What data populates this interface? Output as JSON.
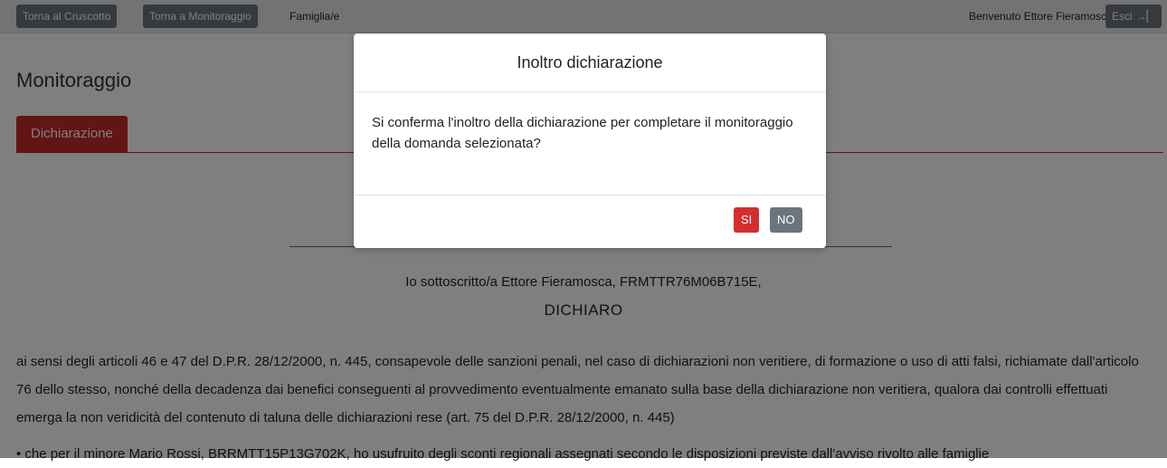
{
  "topbar": {
    "back_dashboard": "Torna al Cruscotto",
    "back_monitoring": "Torna a Monitoraggio",
    "breadcrumb": "Famiglia/e",
    "welcome": "Benvenuto Ettore Fieramosca",
    "logout_label": "Esci",
    "logout_icon": "sign-out-icon"
  },
  "page": {
    "title": "Monitoraggio",
    "tab": "Dichiarazione"
  },
  "declaration": {
    "subject": "Io sottoscritto/a Ettore Fieramosca, FRMTTR76M06B715E,",
    "heading": "DICHIARO",
    "paragraph": "ai sensi degli articoli 46 e 47 del D.P.R. 28/12/2000, n. 445, consapevole delle sanzioni penali, nel caso di dichiarazioni non veritiere, di formazione o uso di atti falsi, richiamate dall'articolo 76 dello stesso, nonché della decadenza dai benefici conseguenti al provvedimento eventualmente emanato sulla base della dichiarazione non veritiera, qualora dai controlli effettuati emerga la non veridicità del contenuto di taluna delle dichiarazioni rese (art. 75 del D.P.R. 28/12/2000, n. 445)",
    "bullet": "che per il minore Mario Rossi, BRRMTT15P13G702K, ho usufruito degli sconti regionali assegnati secondo le disposizioni previste dall'avviso rivolto alle famiglie"
  },
  "modal": {
    "title": "Inoltro dichiarazione",
    "message": "Si conferma l'inoltro della dichiarazione per completare il monitoraggio della domanda selezionata?",
    "yes_label": "SI",
    "no_label": "NO"
  },
  "colors": {
    "accent": "#c62828",
    "button_dark": "#6c757d"
  }
}
